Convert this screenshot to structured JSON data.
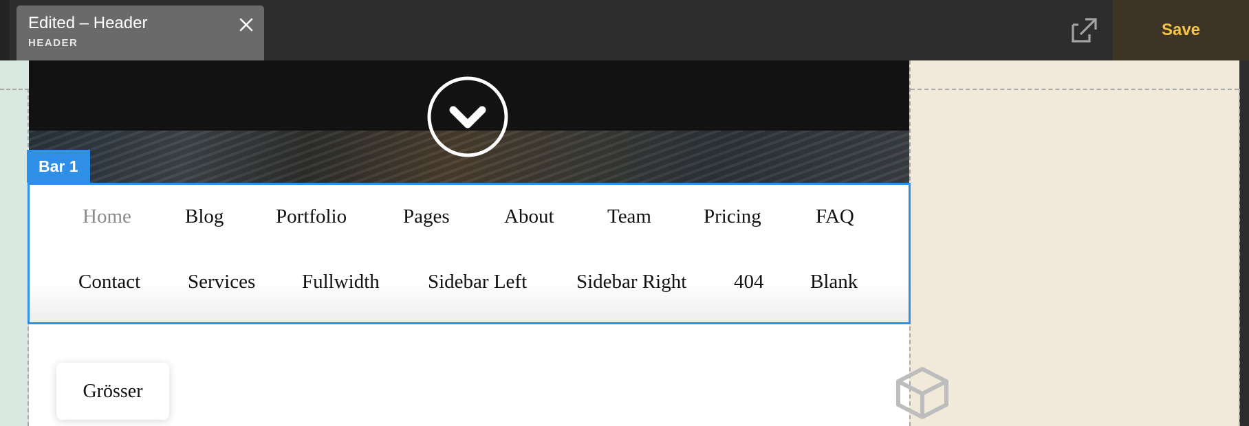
{
  "toolbar": {
    "edit_title": "Edited – Header",
    "edit_subtitle": "HEADER",
    "close_icon": "close-icon",
    "external_icon": "external-link-icon",
    "save_label": "Save",
    "save_color": "#f3c348"
  },
  "canvas": {
    "bar_tag": "Bar 1",
    "scroll_icon": "chevron-down-circle-icon",
    "menu": {
      "row1": [
        "Home",
        "Blog",
        "Portfolio",
        "Pages",
        "About",
        "Team",
        "Pricing",
        "FAQ"
      ],
      "row2": [
        "Contact",
        "Services",
        "Fullwidth",
        "Sidebar Left",
        "Sidebar Right",
        "404",
        "Blank"
      ],
      "active_item": "Home"
    },
    "groesser_label": "Grösser",
    "cube_icon": "cube-icon",
    "accent_color": "#2f8ee5"
  }
}
